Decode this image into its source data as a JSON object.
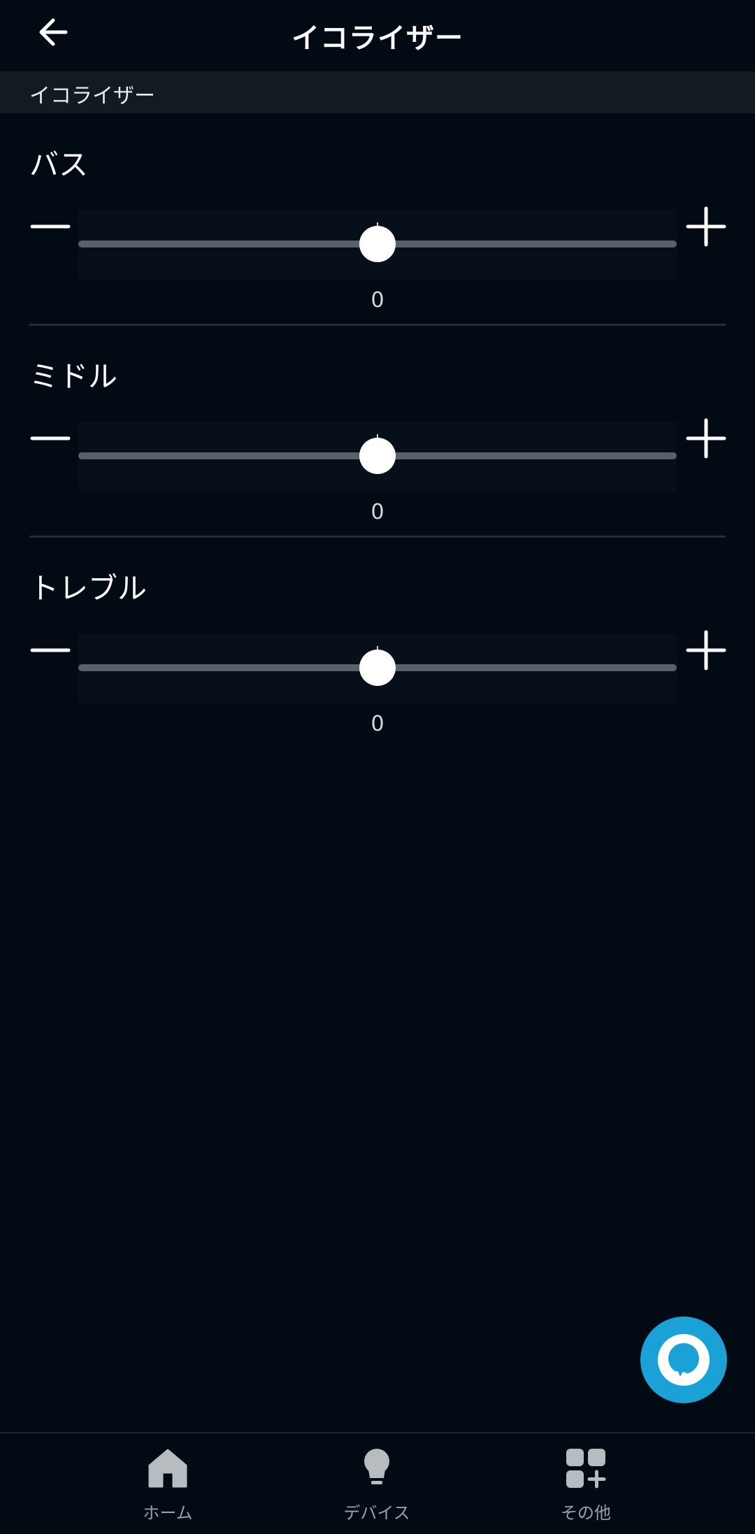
{
  "header": {
    "title": "イコライザー",
    "back_icon": "arrow-left-icon"
  },
  "section": {
    "label": "イコライザー"
  },
  "bands": [
    {
      "label": "バス",
      "value": "0",
      "level": 0.5
    },
    {
      "label": "ミドル",
      "value": "0",
      "level": 0.5
    },
    {
      "label": "トレブル",
      "value": "0",
      "level": 0.5
    }
  ],
  "fab": {
    "icon": "alexa-icon",
    "color": "#1aa1d6"
  },
  "nav": {
    "items": [
      {
        "label": "ホーム",
        "icon": "home-icon"
      },
      {
        "label": "デバイス",
        "icon": "lightbulb-icon"
      },
      {
        "label": "その他",
        "icon": "grid-plus-icon"
      }
    ]
  },
  "colors": {
    "background": "#020a13",
    "section_bg": "#121b22",
    "track": "#5a6067",
    "accent": "#1aa1d6"
  }
}
